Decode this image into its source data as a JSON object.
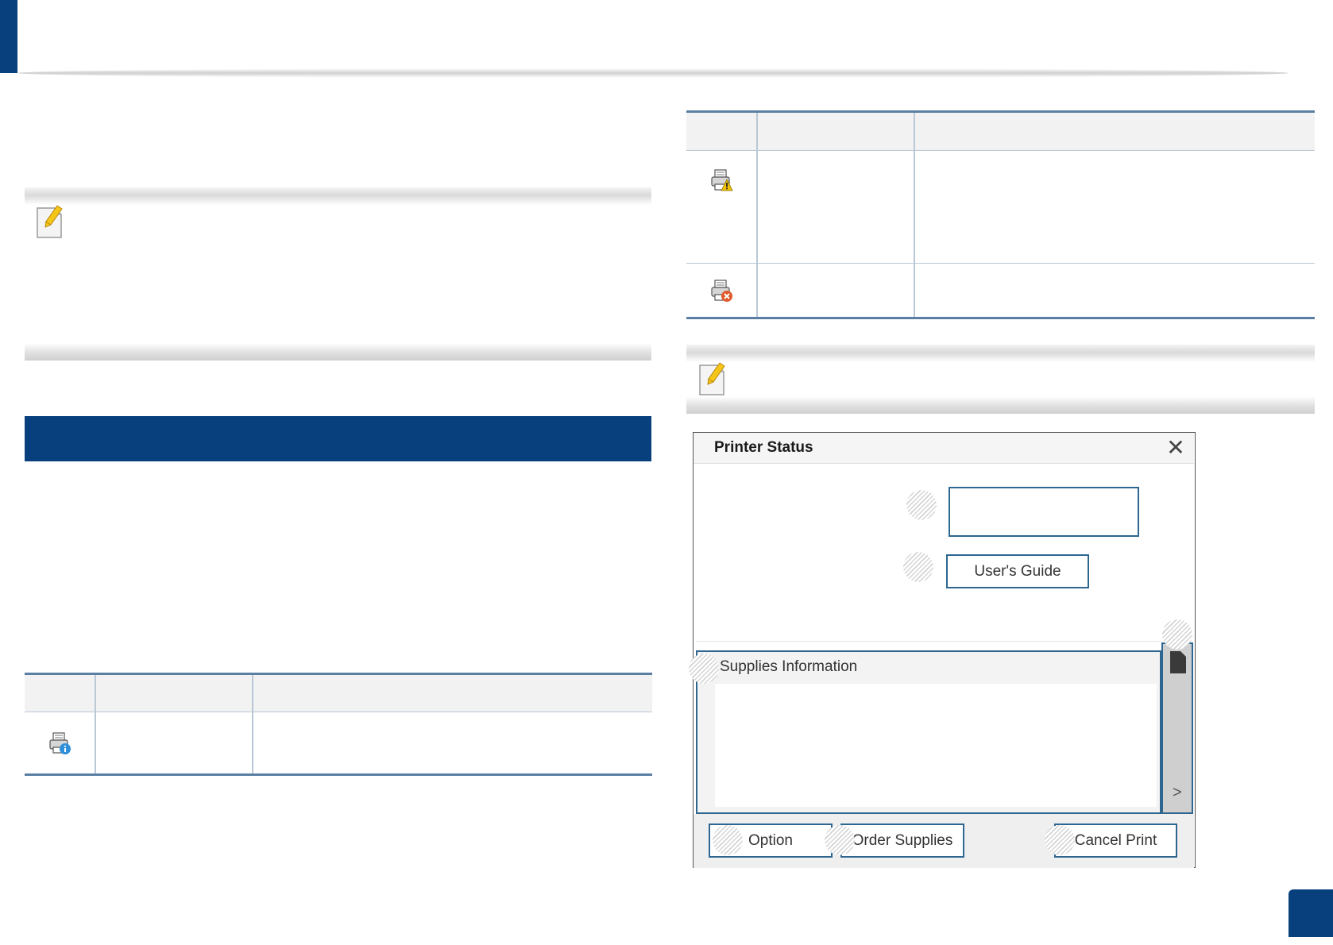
{
  "dialog": {
    "title": "Printer Status",
    "close_symbol": "✕",
    "users_guide_label": "User's Guide",
    "supplies_label": "Supplies Information",
    "option_label": "Option",
    "order_supplies_label": "Order Supplies",
    "cancel_print_label": "Cancel Print",
    "chevron_symbol": ">"
  },
  "icons": {
    "note_1": "note-pencil-icon",
    "note_2": "note-pencil-icon",
    "status_info": "printer-info-icon",
    "status_warning": "printer-warning-icon",
    "status_error": "printer-error-icon",
    "toner": "toner-cartridge-icon"
  },
  "colors": {
    "brand_blue": "#07407d",
    "table_rule": "#5b7fa3",
    "button_border": "#2e6690"
  }
}
